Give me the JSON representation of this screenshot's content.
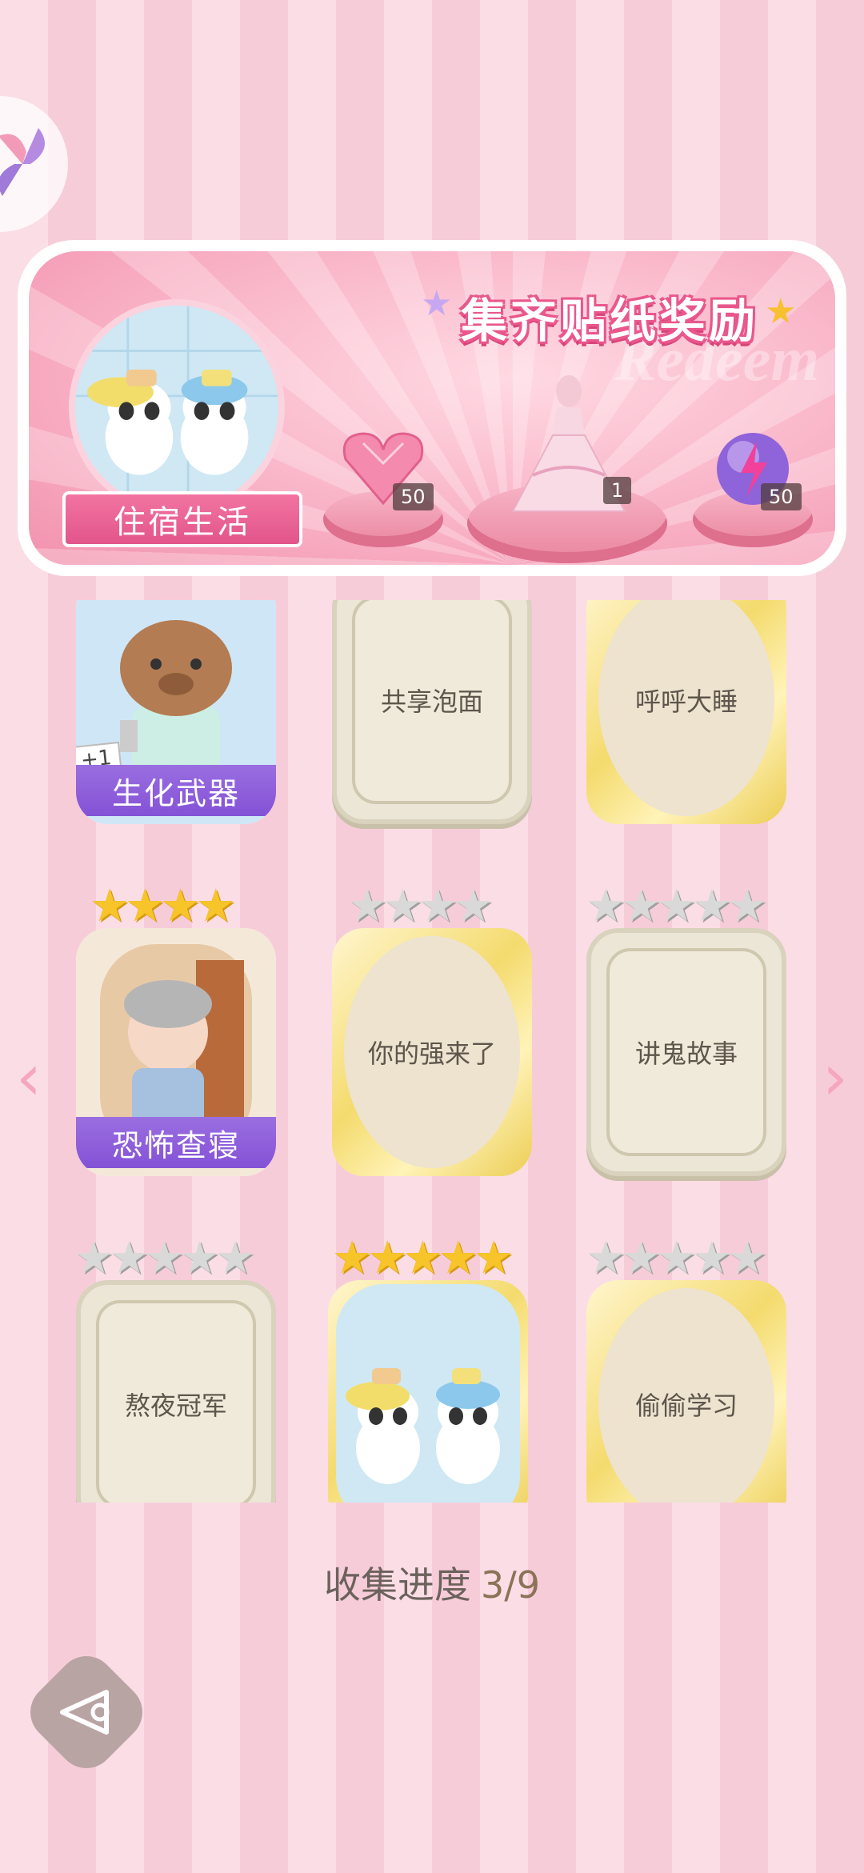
{
  "banner": {
    "title": "集齐贴纸奖励",
    "watermark": "Redeem",
    "theme_name": "住宿生活",
    "rewards": [
      {
        "icon": "pink-diamond-heart-icon",
        "count": "50"
      },
      {
        "icon": "princess-dress-icon",
        "count": "1"
      },
      {
        "icon": "energy-orb-icon",
        "count": "50"
      }
    ]
  },
  "cards": [
    {
      "name": "生化武器",
      "collected": true,
      "plus_badge": "+1",
      "stars": 0
    },
    {
      "name": "共享泡面",
      "collected": false,
      "style": "frame",
      "stars": 0
    },
    {
      "name": "呼呼大睡",
      "collected": false,
      "style": "gold",
      "stars": 0
    },
    {
      "name": "恐怖查寝",
      "collected": true,
      "stars_gold": 4
    },
    {
      "name": "你的强来了",
      "collected": false,
      "style": "gold",
      "stars_grey": 4
    },
    {
      "name": "讲鬼故事",
      "collected": false,
      "style": "frame",
      "stars_grey": 5
    },
    {
      "name": "熬夜冠军",
      "collected": false,
      "style": "frame",
      "stars_grey": 5
    },
    {
      "name": "",
      "collected": true,
      "stars_gold": 5
    },
    {
      "name": "偷偷学习",
      "collected": false,
      "style": "gold",
      "stars_grey": 5
    }
  ],
  "progress": {
    "label": "收集进度",
    "value": "3/9"
  },
  "nav": {
    "prev": "‹",
    "next": "›"
  }
}
